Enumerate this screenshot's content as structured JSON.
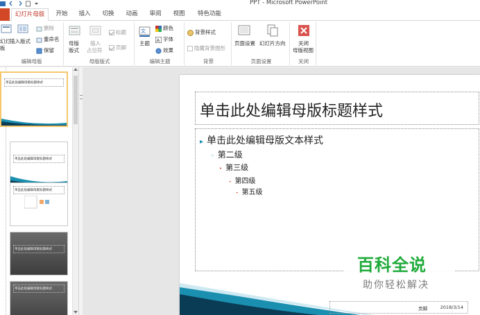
{
  "window": {
    "title": "PPT - Microsoft PowerPoint"
  },
  "tabs": {
    "file": "",
    "slide_master": "幻灯片母版",
    "home": "开始",
    "insert": "插入",
    "transitions": "切换",
    "animations": "动画",
    "review": "审阅",
    "view": "视图",
    "special": "特色功能"
  },
  "ribbon": {
    "edit_master": {
      "label": "编辑母版",
      "insert_slide_master": "幻灯",
      "insert_slide_master_line2": "板",
      "insert_layout": "插入版式",
      "delete": "删除",
      "rename": "重命名",
      "preserve": "保留"
    },
    "master_layout": {
      "label": "母版版式",
      "master_layout": "母版",
      "master_layout_line2": "版式",
      "insert_placeholder": "插入",
      "insert_placeholder_line2": "占位符",
      "title": "标题",
      "footers": "页脚"
    },
    "edit_theme": {
      "label": "编辑主题",
      "themes": "主题",
      "colors": "颜色",
      "fonts": "字体",
      "effects": "效果"
    },
    "background": {
      "label": "背景",
      "background_styles": "背景样式",
      "hide_background": "隐藏背景图形"
    },
    "page_setup": {
      "label": "页面设置",
      "page_setup": "页面设置",
      "slide_orientation": "幻灯片方向"
    },
    "close": {
      "label": "关闭",
      "close_master": "关闭",
      "close_master_line2": "母版视图"
    }
  },
  "thumbnails": [
    {
      "title": "单击此处编辑母版标题样式"
    },
    {
      "title": "单击此处编辑母版标题样式"
    },
    {
      "title": "单击此处编辑母版标题样式"
    },
    {
      "title": "单击此处编辑母版标题样式"
    },
    {
      "title": "单击此处编辑母版标题样式"
    }
  ],
  "slide": {
    "title": "单击此处编辑母版标题样式",
    "levels": [
      "单击此处编辑母版文本样式",
      "第二级",
      "第三级",
      "第四级",
      "第五级"
    ],
    "footer_label": "页脚",
    "date": "2018/3/14"
  },
  "watermark": {
    "title": "百科全说",
    "subtitle": "助你轻松解决"
  },
  "colors": {
    "accent_red": "#d24726",
    "wave_blue": "#1a8fb0",
    "watermark_green": "#1faa3a"
  }
}
